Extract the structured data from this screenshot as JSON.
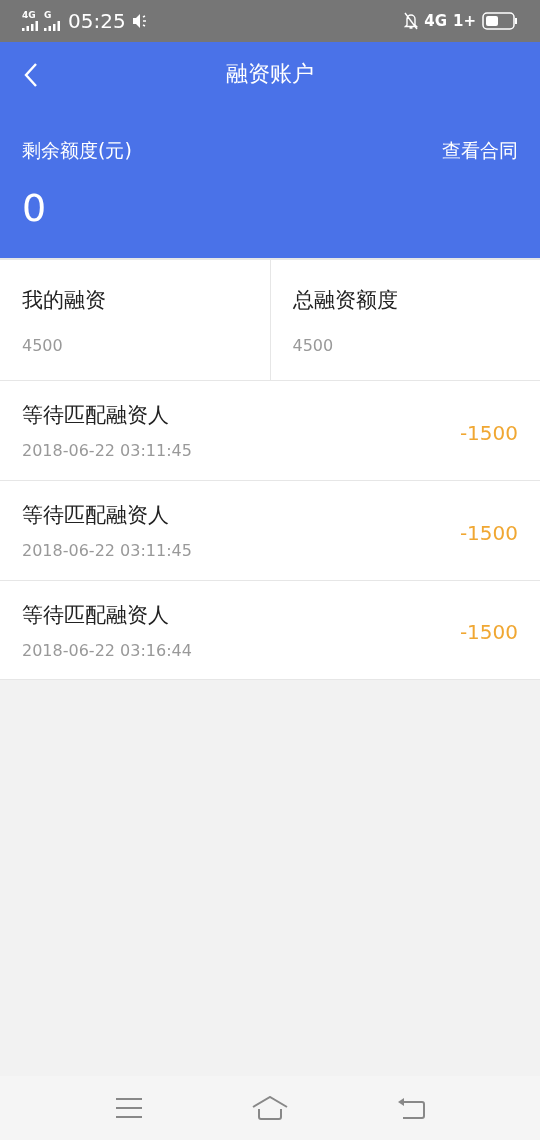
{
  "status_bar": {
    "left_networks": [
      "4G",
      "G"
    ],
    "time": "05:25",
    "right_network": "4G",
    "right_suffix": "1+"
  },
  "header": {
    "title": "融资账户",
    "balance_label": "剩余额度(元)",
    "contract_link": "查看合同",
    "balance": "0"
  },
  "stats": [
    {
      "label": "我的融资",
      "value": "4500"
    },
    {
      "label": "总融资额度",
      "value": "4500"
    }
  ],
  "records": [
    {
      "title": "等待匹配融资人",
      "time": "2018-06-22 03:11:45",
      "amount": "-1500"
    },
    {
      "title": "等待匹配融资人",
      "time": "2018-06-22 03:11:45",
      "amount": "-1500"
    },
    {
      "title": "等待匹配融资人",
      "time": "2018-06-22 03:16:44",
      "amount": "-1500"
    }
  ]
}
